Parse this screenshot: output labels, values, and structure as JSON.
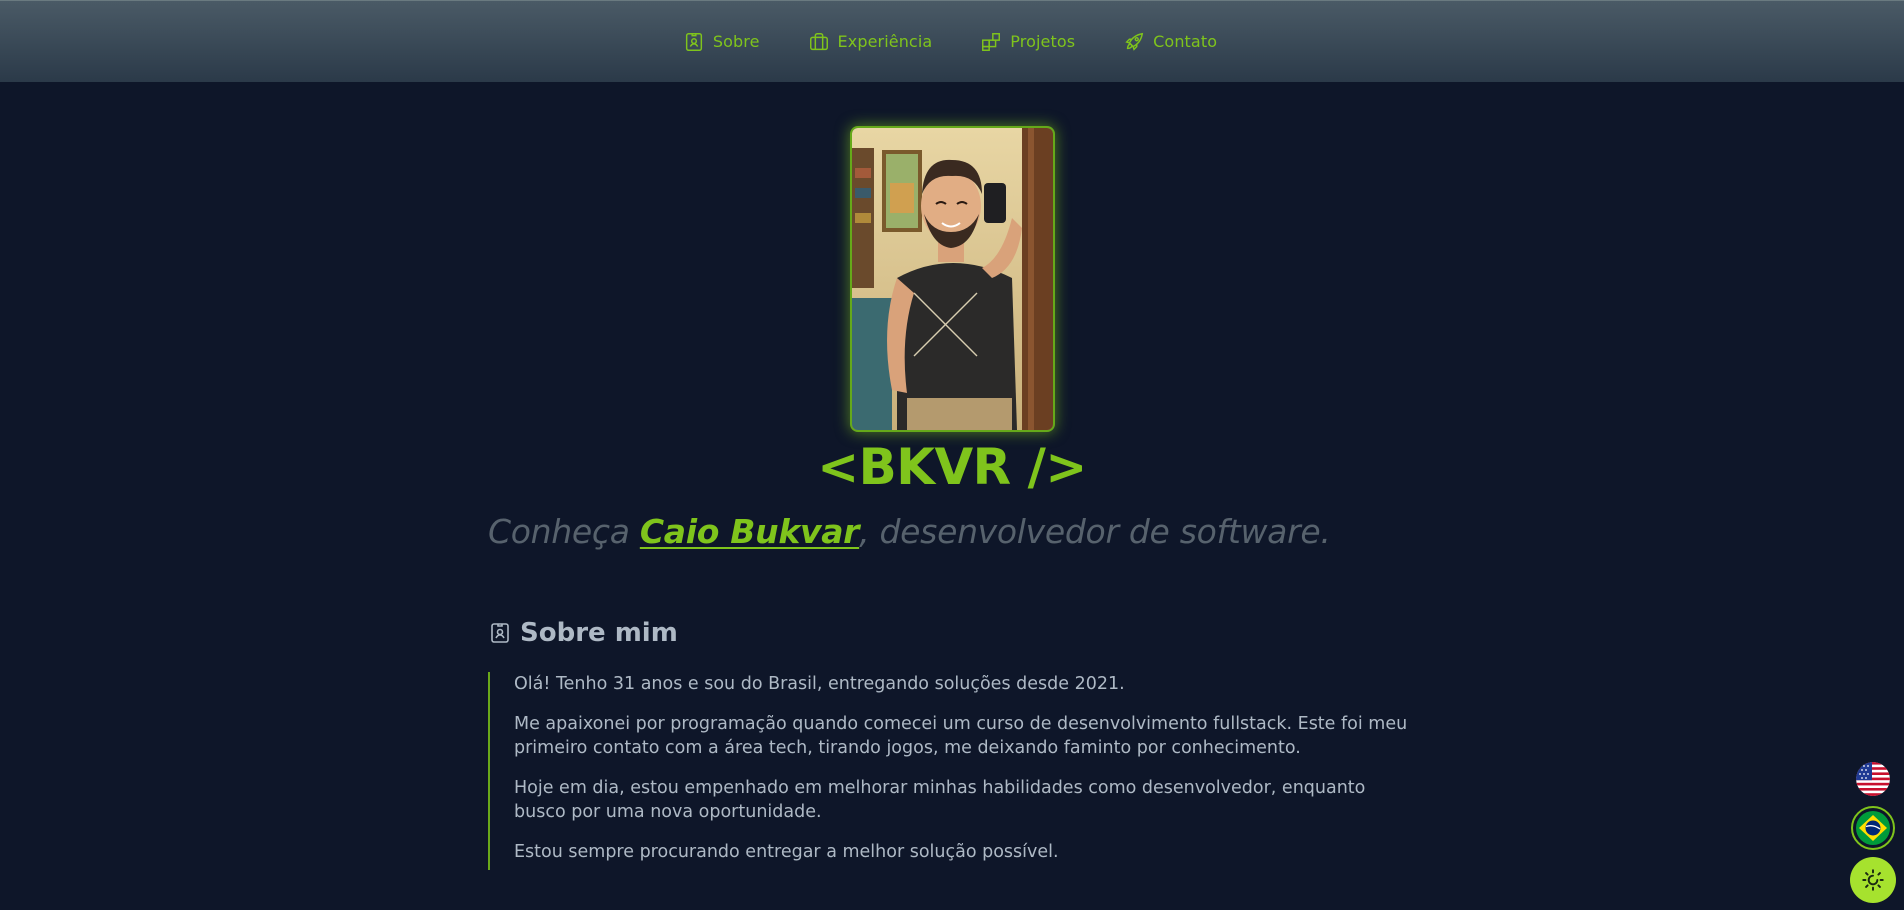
{
  "nav": {
    "items": [
      {
        "label": "Sobre",
        "icon": "id-badge-icon"
      },
      {
        "label": "Experiência",
        "icon": "briefcase-icon"
      },
      {
        "label": "Projetos",
        "icon": "blocks-icon"
      },
      {
        "label": "Contato",
        "icon": "rocket-icon"
      }
    ]
  },
  "hero": {
    "logo": "<BKVR />",
    "tagline_prefix": "Conheça ",
    "tagline_name": "Caio Bukvar",
    "tagline_suffix": ", desenvolvedor de software."
  },
  "about": {
    "title": "Sobre mim",
    "paragraphs": [
      "Olá! Tenho 31 anos e sou do Brasil, entregando soluções desde 2021.",
      "Me apaixonei por programação quando comecei um curso de desenvolvimento fullstack. Este foi meu primeiro contato com a área tech, tirando jogos, me deixando faminto por conhecimento.",
      "Hoje em dia, estou empenhado em melhorar minhas habilidades como desenvolvedor, enquanto busco por uma nova oportunidade.",
      "Estou sempre procurando entregar a melhor solução possível."
    ]
  },
  "controls": {
    "lang_en_icon": "us-flag-icon",
    "lang_pt_icon": "brazil-flag-icon",
    "theme_icon": "sun-icon"
  },
  "colors": {
    "accent": "#7fc41c",
    "background": "#0e1629",
    "text": "#aeb9c5",
    "muted": "#57626d"
  }
}
